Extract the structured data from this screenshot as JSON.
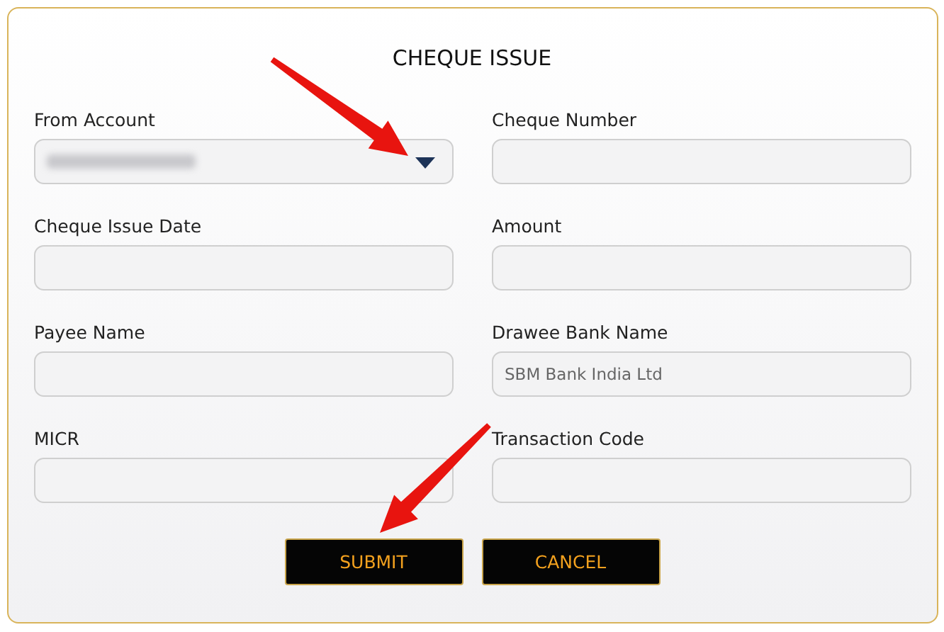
{
  "title": "CHEQUE ISSUE",
  "fields": [
    {
      "label": "From Account",
      "kind": "select",
      "blurred": true
    },
    {
      "label": "Cheque Number",
      "kind": "input"
    },
    {
      "label": "Cheque Issue Date",
      "kind": "input"
    },
    {
      "label": "Amount",
      "kind": "input"
    },
    {
      "label": "Payee Name",
      "kind": "input"
    },
    {
      "label": "Drawee Bank Name",
      "kind": "input",
      "value": "SBM Bank India Ltd"
    },
    {
      "label": "MICR",
      "kind": "input"
    },
    {
      "label": "Transaction Code",
      "kind": "input"
    }
  ],
  "buttons": [
    "SUBMIT",
    "CANCEL"
  ]
}
